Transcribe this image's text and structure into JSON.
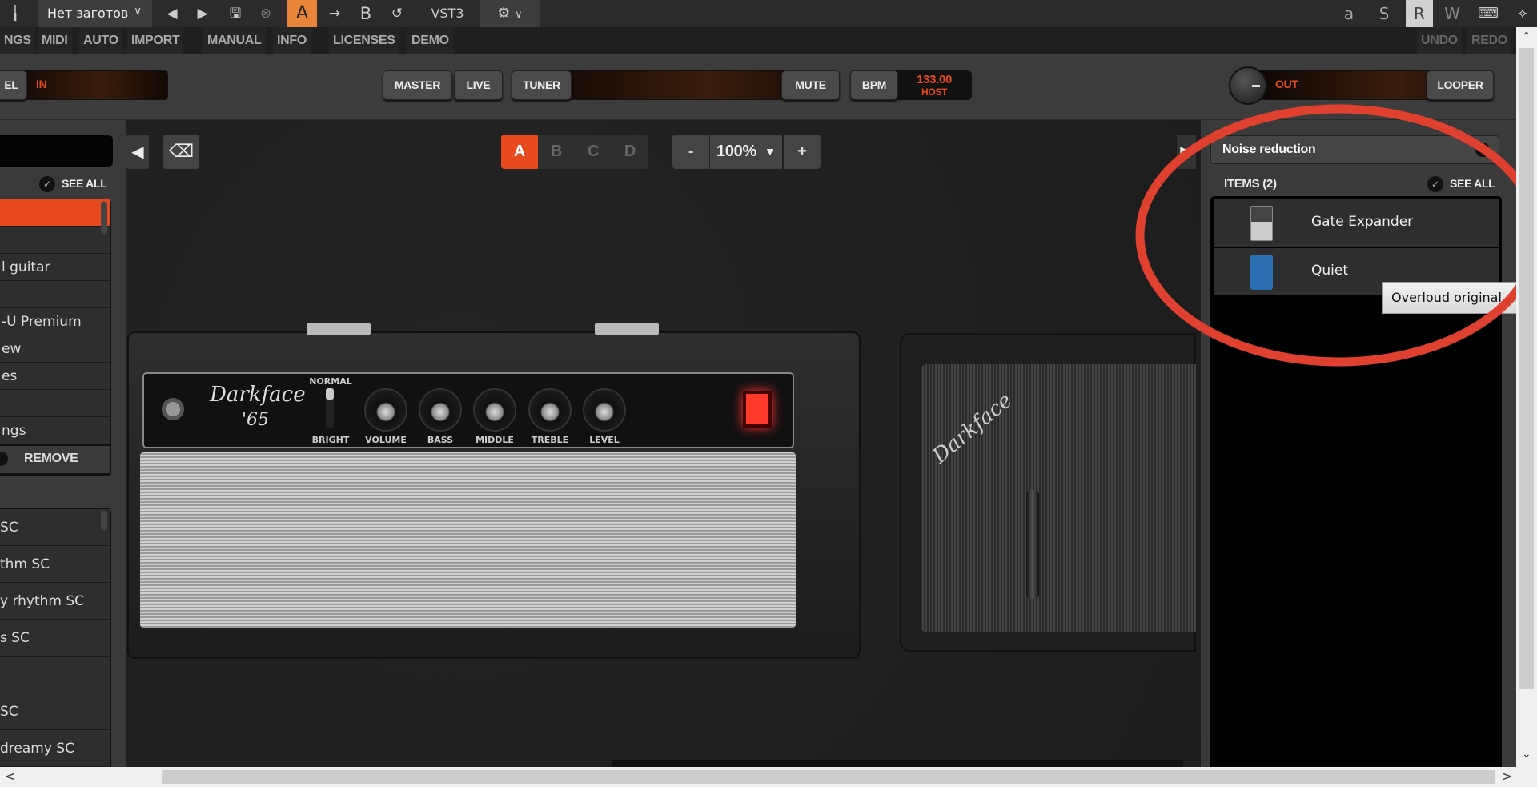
{
  "topbar": {
    "preset": "Нет заготов",
    "a_label": "A",
    "b_label": "B",
    "format": "VST3",
    "right_buttons": [
      "a",
      "S",
      "R",
      "W"
    ],
    "icons": [
      "menu-icon",
      "chevron-down-icon",
      "prev-icon",
      "next-icon",
      "save-icon",
      "close-circle-icon",
      "arrow-right-icon",
      "undo-icon",
      "gear-icon",
      "keyboard-icon",
      "pin-icon"
    ]
  },
  "menubar": {
    "items": [
      "NGS",
      "MIDI",
      "AUTO",
      "IMPORT",
      "MANUAL",
      "INFO",
      "LICENSES",
      "DEMO"
    ],
    "undo": "UNDO",
    "redo": "REDO"
  },
  "strip": {
    "level": "EL",
    "in": "IN",
    "master": "MASTER",
    "live": "LIVE",
    "tuner": "TUNER",
    "mute": "MUTE",
    "bpm": "BPM",
    "bpm_value": "133.00",
    "bpm_source": "HOST",
    "out": "OUT",
    "looper": "LOOPER"
  },
  "left": {
    "see_all": "SEE ALL",
    "list1": [
      "",
      "",
      "l guitar",
      "",
      "-U Premium",
      "ew",
      "es",
      "",
      "ngs"
    ],
    "remove": "REMOVE",
    "list2": [
      "SC",
      "thm SC",
      "y rhythm SC",
      "s SC",
      "",
      "SC",
      "dreamy SC"
    ]
  },
  "scenes": [
    "A",
    "B",
    "C",
    "D"
  ],
  "zoom": {
    "minus": "-",
    "value": "100%",
    "plus": "+"
  },
  "amp": {
    "brand_line1": "Darkface",
    "brand_line2": "'65",
    "switch_top": "NORMAL",
    "switch_bottom": "BRIGHT",
    "knobs": [
      "VOLUME",
      "BASS",
      "MIDDLE",
      "TREBLE",
      "LEVEL"
    ],
    "cab_logo": "Darkface"
  },
  "right": {
    "category": "Noise reduction",
    "items_label": "ITEMS (2)",
    "see_all": "SEE ALL",
    "items": [
      {
        "name": "Gate Expander",
        "icon": "gate-expander-pedal-icon"
      },
      {
        "name": "Quiet",
        "icon": "quiet-pedal-icon"
      }
    ],
    "tooltip": "Overloud original mo"
  },
  "colors": {
    "accent": "#e64a1e",
    "orange_tab": "#e8853a",
    "annotation": "#e04030"
  }
}
